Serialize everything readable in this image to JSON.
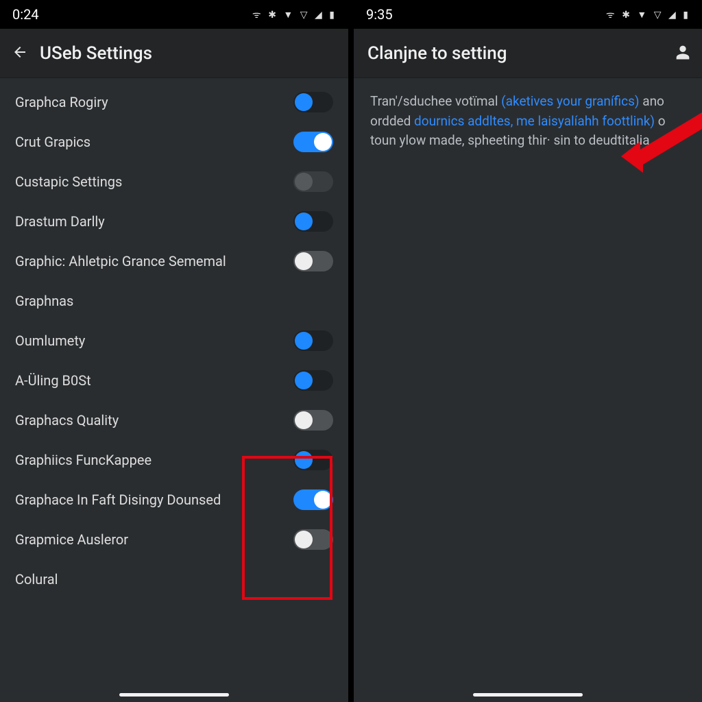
{
  "leftPhone": {
    "statusTime": "0:24",
    "title": "USeb Settings",
    "items": [
      {
        "label": "Graphca Rogiry",
        "toggleClass": "on-blue-left",
        "hasToggle": true
      },
      {
        "label": "Crut Grapics",
        "toggleClass": "on-blue-right",
        "hasToggle": true
      },
      {
        "label": "Custapic Settings",
        "toggleClass": "off-dark",
        "hasToggle": true
      },
      {
        "label": "Drastum Darlly",
        "toggleClass": "on-blue-left",
        "hasToggle": true
      },
      {
        "label": "Graphic: Ahletpic Grance Sememal",
        "toggleClass": "off-white-left",
        "hasToggle": true
      },
      {
        "label": "Graphnas",
        "toggleClass": "",
        "hasToggle": false
      },
      {
        "label": "Oumlumety",
        "toggleClass": "on-blue-left",
        "hasToggle": true
      },
      {
        "label": "A-Üling B0St",
        "toggleClass": "on-blue-left",
        "hasToggle": true
      },
      {
        "label": "Graphacs Quality",
        "toggleClass": "off-white-left",
        "hasToggle": true
      },
      {
        "label": "Graphiics FuncKappee",
        "toggleClass": "on-blue-left",
        "hasToggle": true
      },
      {
        "label": "Graphace In Faft Disingy Dounsed",
        "toggleClass": "on-blue-right",
        "hasToggle": true
      },
      {
        "label": "Grapmice Ausleror",
        "toggleClass": "off-white-left",
        "hasToggle": true
      },
      {
        "label": "Colural",
        "toggleClass": "",
        "hasToggle": false
      }
    ]
  },
  "rightPhone": {
    "statusTime": "9:35",
    "title": "Clanjne to setting",
    "paragraph": {
      "t1": "Tran'/sduchee votïmal ",
      "l1": "(aketives your granífics)",
      "t2": " ano ordded ",
      "l2": "dournics addltes, me laisyalíahh foottlink)",
      "t3": " o toun ylow made, spheeting thir·     sin to deudtitalia."
    }
  },
  "colors": {
    "accent": "#1e88ff",
    "highlight": "#e30613"
  }
}
